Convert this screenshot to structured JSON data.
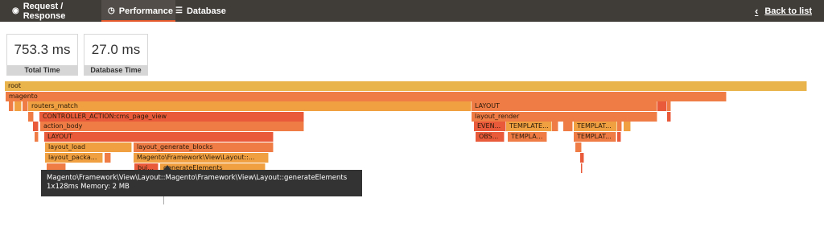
{
  "nav": {
    "tabs": [
      {
        "label": "Request / Response",
        "icon": "globe-icon"
      },
      {
        "label": "Performance",
        "icon": "clock-icon"
      },
      {
        "label": "Database",
        "icon": "database-icon"
      }
    ],
    "back_label": "Back to list"
  },
  "stats": {
    "total_time": {
      "value": "753.3 ms",
      "label": "Total Time"
    },
    "db_time": {
      "value": "27.0 ms",
      "label": "Database Time"
    }
  },
  "flame": {
    "root": "root",
    "magento": "magento",
    "routers_match": "routers_match",
    "layout_right": "LAYOUT",
    "controller_action": "CONTROLLER_ACTION:cms_page_view",
    "layout_render": "layout_render",
    "action_body": "action_body",
    "even": "EVEN...",
    "template_1": "TEMPLATE...",
    "template_2": "TEMPLAT...",
    "layout_left": "LAYOUT",
    "obs": "OBS...",
    "templa_1": "TEMPLA...",
    "templat_3": "TEMPLAT...",
    "layout_load": "layout_load",
    "layout_generate_blocks": "layout_generate_blocks",
    "layout_package": "layout_packa...",
    "layout_generate_elements_frame": "Magento\\Framework\\View\\Layout::...",
    "bui": "bui...",
    "generate_elements": "generateElements"
  },
  "tooltip": {
    "title": "Magento\\Framework\\View\\Layout::Magento\\Framework\\View\\Layout::generateElements",
    "detail": "1x128ms Memory: 2 MB"
  },
  "colors": {
    "nav_bg": "#403c38",
    "active_accent": "#e5592d",
    "root": "#e9b44c",
    "magento": "#ef7c45",
    "mid": "#f0a040",
    "hot": "#e95a3a"
  }
}
